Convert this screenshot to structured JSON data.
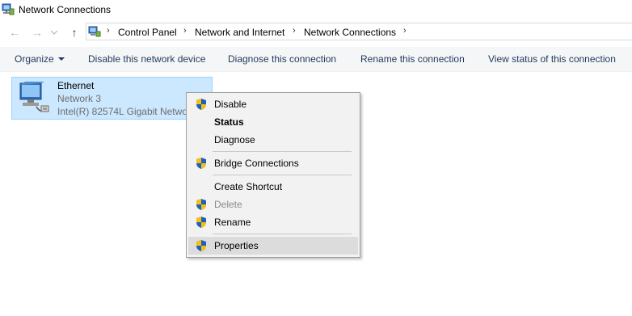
{
  "window": {
    "title": "Network Connections"
  },
  "breadcrumb": [
    "Control Panel",
    "Network and Internet",
    "Network Connections"
  ],
  "toolbar": {
    "organize": "Organize",
    "disable": "Disable this network device",
    "diagnose": "Diagnose this connection",
    "rename": "Rename this connection",
    "view_status": "View status of this connection"
  },
  "connection": {
    "name": "Ethernet",
    "network": "Network  3",
    "adapter": "Intel(R) 82574L Gigabit Network Connection"
  },
  "context_menu": [
    {
      "label": "Disable",
      "shield": true
    },
    {
      "label": "Status",
      "bold": true
    },
    {
      "label": "Diagnose"
    },
    {
      "label": "Bridge Connections",
      "shield": true
    },
    {
      "label": "Create Shortcut"
    },
    {
      "label": "Delete",
      "shield": true,
      "disabled": true
    },
    {
      "label": "Rename",
      "shield": true
    },
    {
      "label": "Properties",
      "shield": true,
      "hover": true
    }
  ],
  "colors": {
    "selection": "#cce8ff",
    "selection_border": "#99d1ff",
    "toolbar_text": "#1e395b",
    "menu_hover": "#dcdcdc"
  }
}
